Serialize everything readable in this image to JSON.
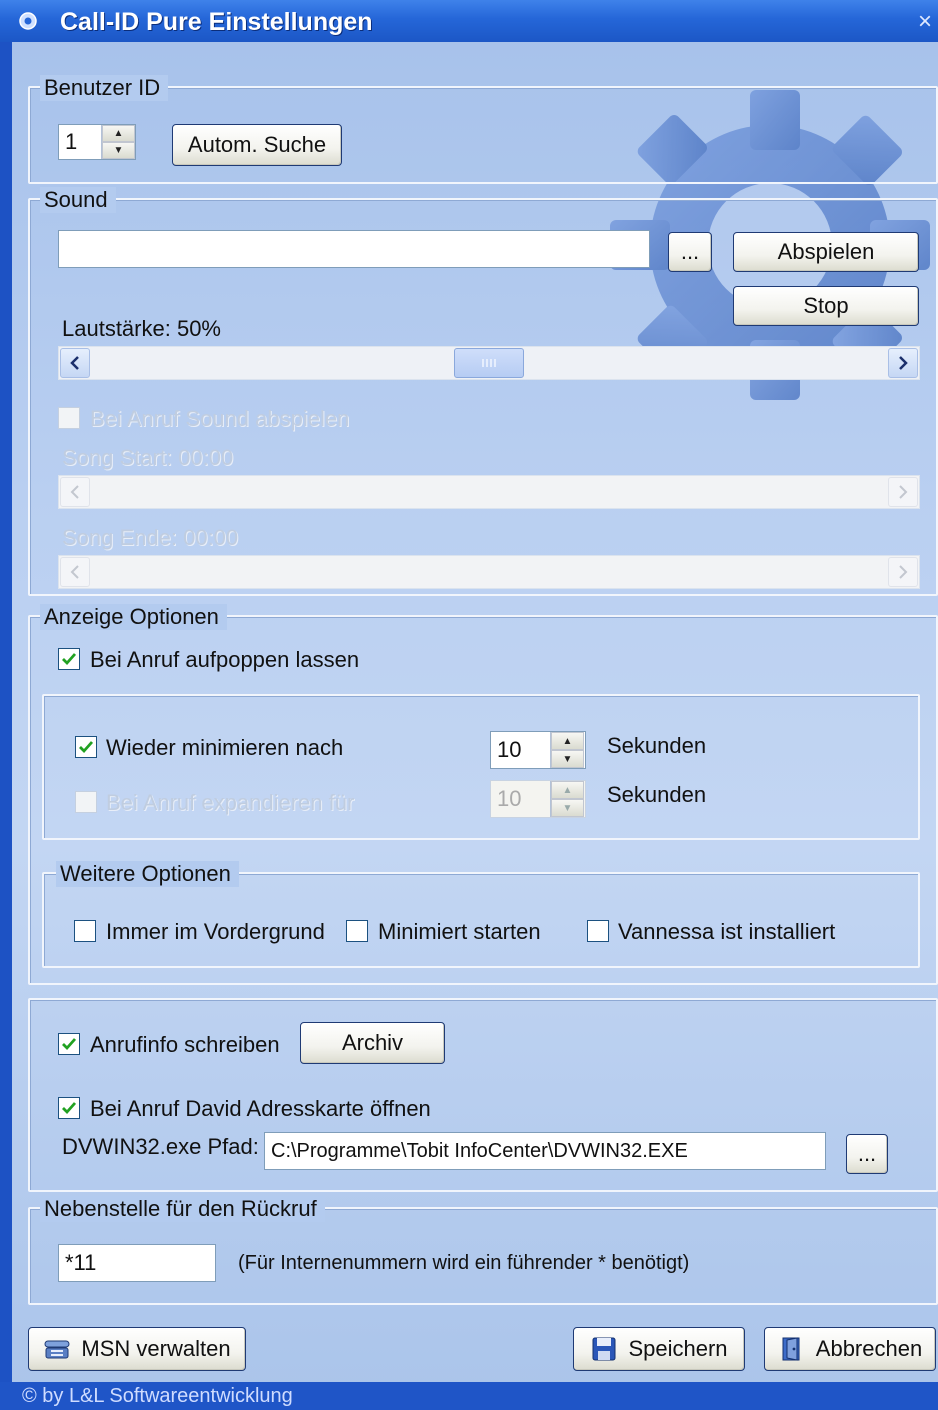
{
  "window": {
    "title": "Call-ID Pure Einstellungen",
    "close": "×",
    "accent": "#2566d8"
  },
  "benutzer": {
    "legend": "Benutzer ID",
    "id_value": "1",
    "search_button": "Autom. Suche"
  },
  "sound": {
    "legend": "Sound",
    "file_value": "",
    "browse_button": "...",
    "play_button": "Abspielen",
    "stop_button": "Stop",
    "volume_label": "Lautstärke: 50%",
    "volume_level": 0.5,
    "play_on_call_label": "Bei Anruf Sound abspielen",
    "play_on_call_checked": false,
    "song_start_label": "Song Start: 00:00",
    "song_end_label": "Song Ende: 00:00"
  },
  "anzeige": {
    "legend": "Anzeige Optionen",
    "popup_label": "Bei Anruf aufpoppen lassen",
    "popup_checked": true,
    "minimize_label": "Wieder minimieren nach",
    "minimize_checked": true,
    "minimize_value": "10",
    "minimize_unit": "Sekunden",
    "expand_label": "Bei Anruf expandieren für",
    "expand_checked": false,
    "expand_value": "10",
    "expand_unit": "Sekunden"
  },
  "weitere": {
    "legend": "Weitere Optionen",
    "always_top_label": "Immer im Vordergrund",
    "always_top_checked": false,
    "start_minimized_label": "Minimiert starten",
    "start_minimized_checked": false,
    "vannessa_label": "Vannessa ist installiert",
    "vannessa_checked": false
  },
  "archiv": {
    "write_info_label": "Anrufinfo schreiben",
    "write_info_checked": true,
    "archive_button": "Archiv",
    "david_label": "Bei Anruf David Adresskarte öffnen",
    "david_checked": true,
    "path_label": "DVWIN32.exe Pfad:",
    "path_value": "C:\\Programme\\Tobit InfoCenter\\DVWIN32.EXE",
    "path_browse": "..."
  },
  "nebenstelle": {
    "legend": "Nebenstelle für den Rückruf",
    "value": "*11",
    "hint": "(Für Internenummern wird ein führender * benötigt)"
  },
  "footer": {
    "msn_button": "MSN verwalten",
    "save_button": "Speichern",
    "cancel_button": "Abbrechen",
    "status_text": "© by L&L Softwareentwicklung"
  },
  "icons": {
    "title": "gear-icon",
    "msn": "phone-icon",
    "save": "floppy-disk-icon",
    "cancel": "door-exit-icon"
  }
}
